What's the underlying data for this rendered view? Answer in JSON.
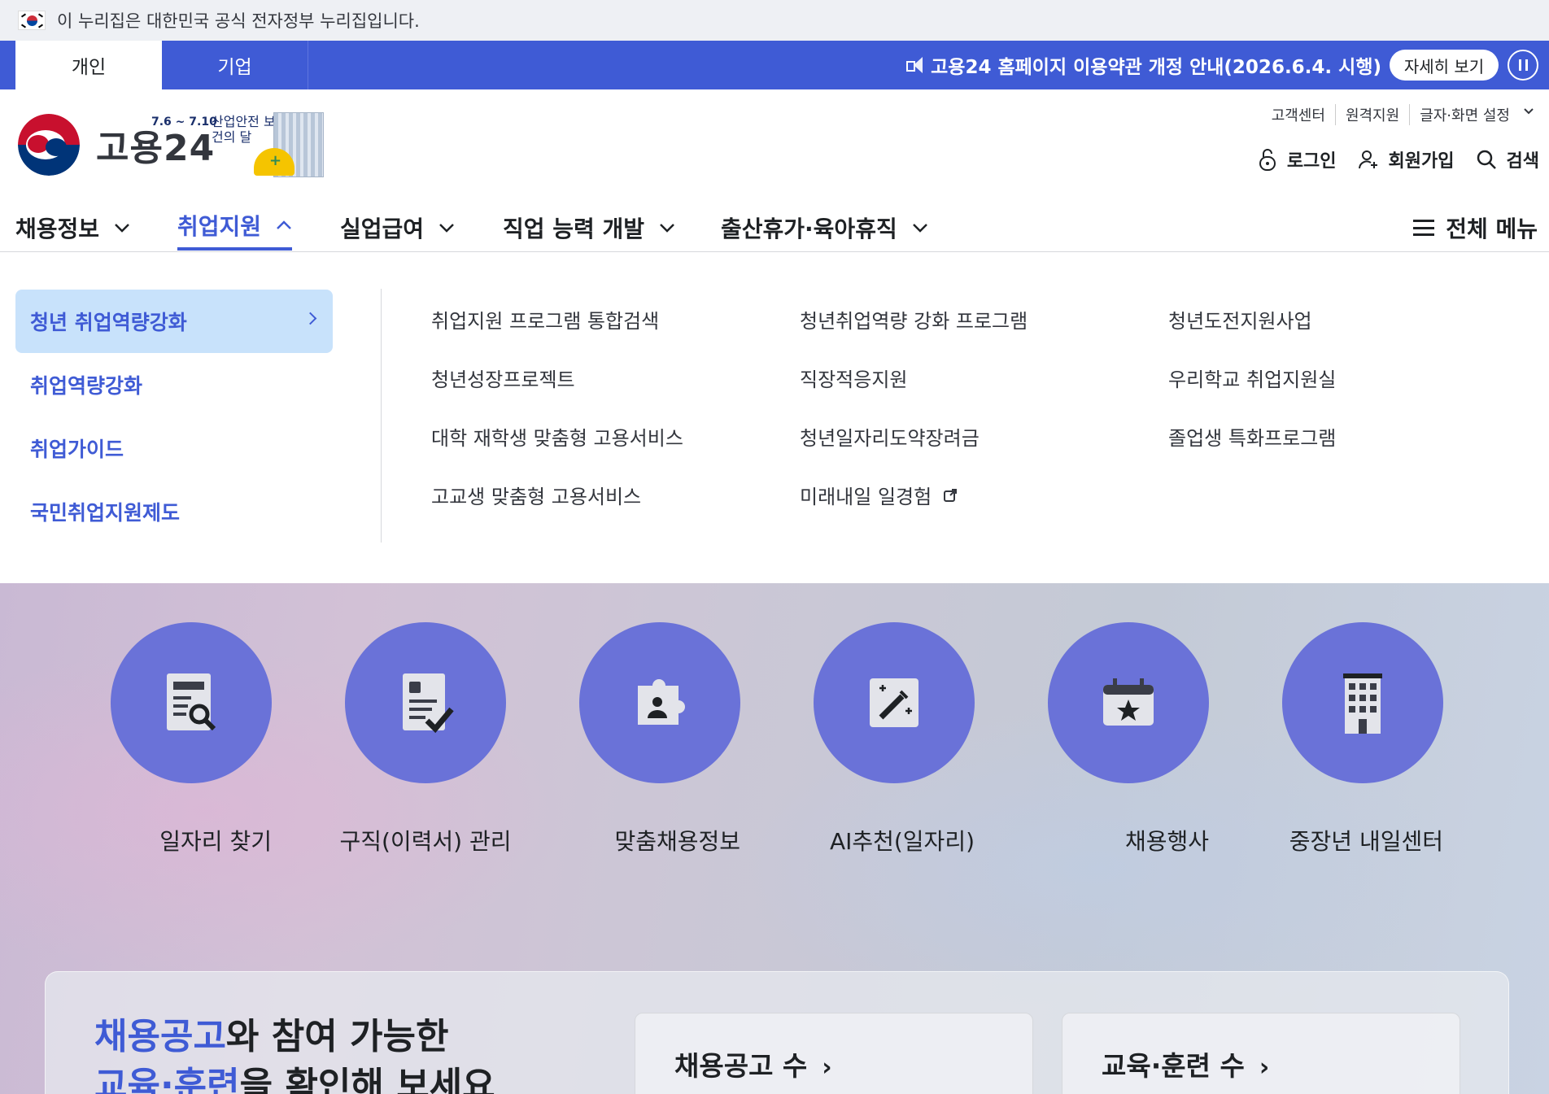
{
  "gov_banner": {
    "text": "이 누리집은 대한민국 공식 전자정부 누리집입니다."
  },
  "top_bar": {
    "tabs": [
      "개인",
      "기업"
    ],
    "notice": "고용24 홈페이지 이용약관 개정 안내(2026.6.4. 시행)",
    "detail_label": "자세히 보기"
  },
  "header": {
    "logo_text": "고용24",
    "campaign_date": "7.6 ~ 7.10",
    "campaign_title": "산업안전 보건의 달",
    "util_links": [
      "고객센터",
      "원격지원",
      "글자·화면 설정"
    ],
    "actions": {
      "login": "로그인",
      "signup": "회원가입",
      "search": "검색"
    }
  },
  "gnb": {
    "items": [
      "채용정보",
      "취업지원",
      "실업급여",
      "직업 능력 개발",
      "출산휴가·육아휴직"
    ],
    "active_index": 1,
    "all_menu": "전체 메뉴"
  },
  "dropdown": {
    "side": [
      "청년 취업역량강화",
      "취업역량강화",
      "취업가이드",
      "국민취업지원제도"
    ],
    "links": [
      "취업지원 프로그램 통합검색",
      "청년취업역량 강화 프로그램",
      "청년도전지원사업",
      "청년성장프로젝트",
      "직장적응지원",
      "우리학교 취업지원실",
      "대학 재학생 맞춤형 고용서비스",
      "청년일자리도약장려금",
      "졸업생 특화프로그램",
      "고교생 맞춤형 고용서비스",
      "미래내일 일경험"
    ]
  },
  "quick_menu": [
    {
      "label": "일자리 찾기",
      "icon": "document-search-icon"
    },
    {
      "label": "구직(이력서) 관리",
      "icon": "resume-check-icon"
    },
    {
      "label": "맞춤채용정보",
      "icon": "puzzle-person-icon"
    },
    {
      "label": "AI추천(일자리)",
      "icon": "magic-wand-icon"
    },
    {
      "label": "채용행사",
      "icon": "calendar-star-icon"
    },
    {
      "label": "중장년 내일센터",
      "icon": "building-icon"
    }
  ],
  "panel": {
    "title_hl1": "채용공고",
    "title_rest1": "와 참여 가능한",
    "title_hl2": "교육·훈련",
    "title_rest2": "을 확인해 보세요",
    "card1": "채용공고 수",
    "card2": "교육·훈련 수"
  },
  "colors": {
    "primary": "#3f5bd5",
    "quick_circle": "#6a72d8",
    "side_active_bg": "#c8e2fb"
  }
}
